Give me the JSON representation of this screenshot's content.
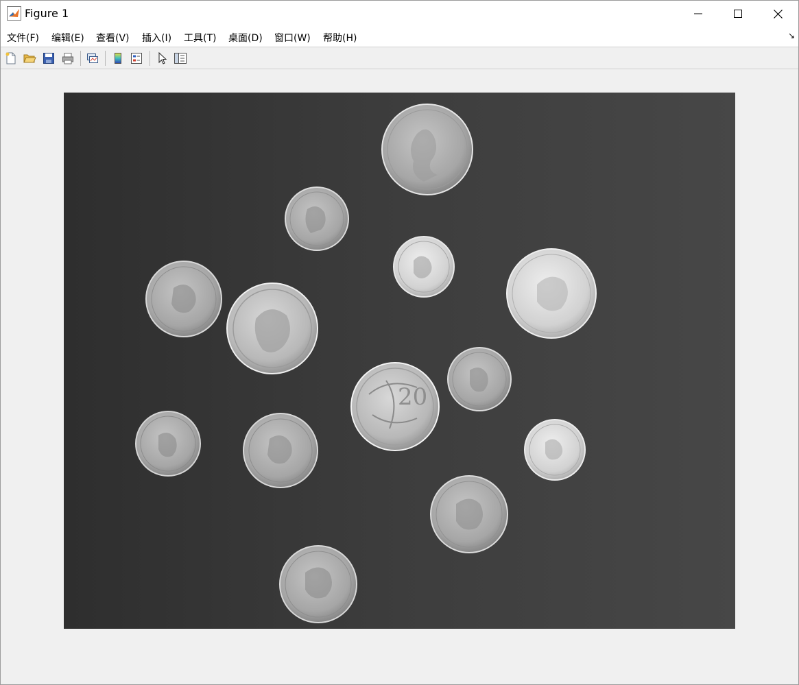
{
  "window": {
    "title": "Figure 1"
  },
  "menu": {
    "items": [
      "文件(F)",
      "编辑(E)",
      "查看(V)",
      "插入(I)",
      "工具(T)",
      "桌面(D)",
      "窗口(W)",
      "帮助(H)"
    ]
  },
  "toolbar": {
    "tools": [
      "new-figure",
      "open-file",
      "save",
      "print",
      "link-plot",
      "insert-colorbar",
      "insert-legend",
      "edit-plot",
      "property-inspector"
    ]
  },
  "image": {
    "content": "grayscale photo of coins"
  }
}
